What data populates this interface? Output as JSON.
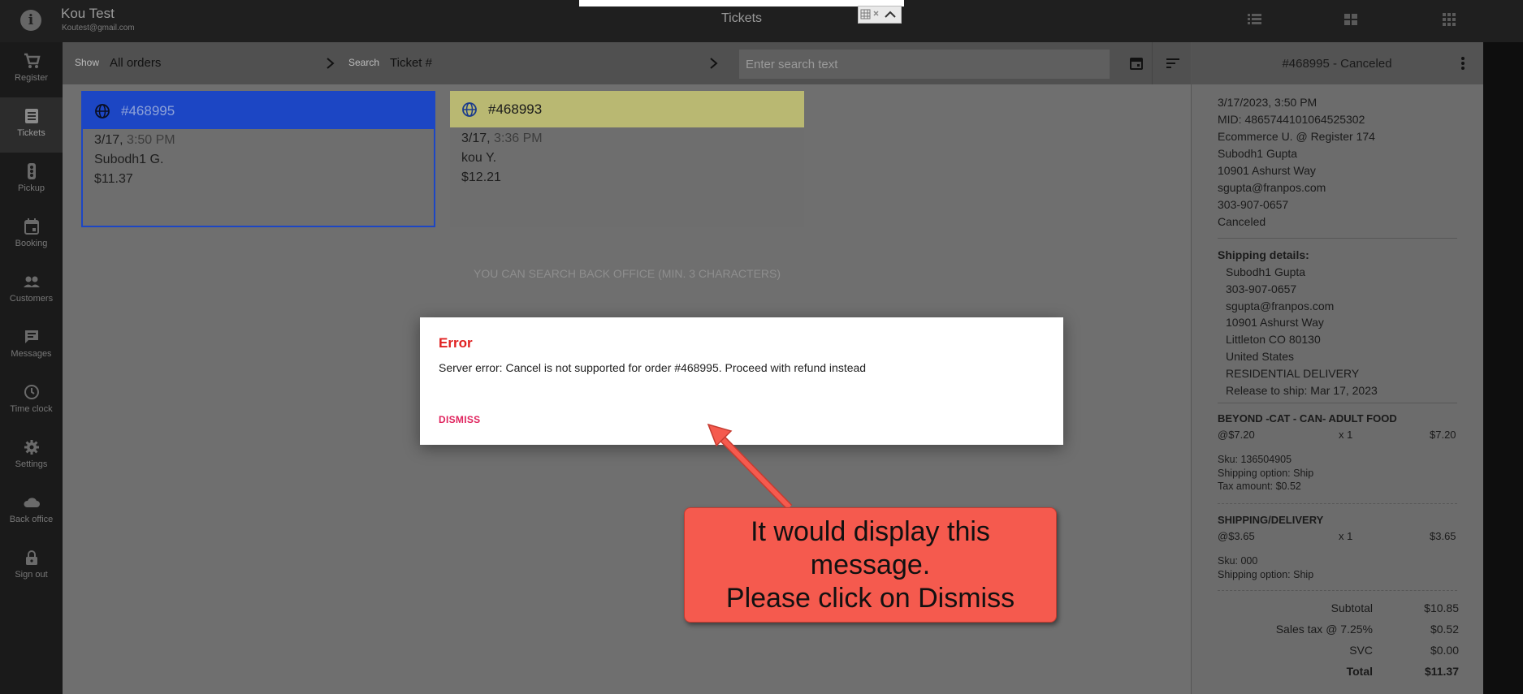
{
  "app": {
    "title": "Tickets"
  },
  "user": {
    "name": "Kou Test",
    "email": "Koutest@gmail.com"
  },
  "nav": [
    {
      "label": "Register",
      "icon": "cart-icon"
    },
    {
      "label": "Tickets",
      "icon": "receipt-icon",
      "active": true
    },
    {
      "label": "Pickup",
      "icon": "traffic-light-icon"
    },
    {
      "label": "Booking",
      "icon": "calendar-icon"
    },
    {
      "label": "Customers",
      "icon": "people-icon"
    },
    {
      "label": "Messages",
      "icon": "chat-icon"
    },
    {
      "label": "Time clock",
      "icon": "clock-icon"
    },
    {
      "label": "Settings",
      "icon": "gear-icon"
    },
    {
      "label": "Back office",
      "icon": "cloud-icon"
    },
    {
      "label": "Sign out",
      "icon": "lock-icon"
    }
  ],
  "toolbar": {
    "show_label": "Show",
    "show_value": "All orders",
    "search_label": "Search",
    "search_value": "Ticket #",
    "search_placeholder": "Enter search text"
  },
  "tickets": [
    {
      "id": "#468995",
      "date": "3/17,",
      "time": "3:50 PM",
      "customer": "Subodh1 G.",
      "total": "$11.37",
      "header_color": "#1c46c4",
      "selected": true
    },
    {
      "id": "#468993",
      "date": "3/17,",
      "time": "3:36 PM",
      "customer": "kou Y.",
      "total": "$12.21",
      "header_color": "#b9b872",
      "selected": false
    }
  ],
  "hint": "YOU CAN SEARCH BACK OFFICE (MIN. 3 CHARACTERS)",
  "detail": {
    "title": "#468995 - Canceled",
    "info_lines": [
      "3/17/2023, 3:50 PM",
      "MID: 4865744101064525302",
      "Ecommerce U. @ Register 174",
      "Subodh1 Gupta",
      "10901 Ashurst Way",
      "sgupta@franpos.com",
      "303-907-0657",
      "Canceled"
    ],
    "shipping_title": "Shipping details:",
    "shipping_lines": [
      "Subodh1 Gupta",
      "303-907-0657",
      "sgupta@franpos.com",
      "10901 Ashurst Way",
      "Littleton CO 80130",
      "United States",
      "RESIDENTIAL DELIVERY",
      "Release to ship: Mar 17, 2023"
    ],
    "items": [
      {
        "name": "BEYOND -CAT - CAN- ADULT FOOD",
        "price": "@$7.20",
        "qty": "x  1",
        "amount": "$7.20",
        "sub": [
          "Sku: 136504905",
          "Shipping option: Ship",
          "Tax amount: $0.52"
        ]
      },
      {
        "name": "SHIPPING/DELIVERY",
        "price": "@$3.65",
        "qty": "x  1",
        "amount": "$3.65",
        "sub": [
          "Sku: 000",
          "Shipping option: Ship"
        ]
      }
    ],
    "totals": [
      {
        "label": "Subtotal",
        "value": "$10.85"
      },
      {
        "label": "Sales tax @ 7.25%",
        "value": "$0.52"
      },
      {
        "label": "SVC",
        "value": "$0.00"
      },
      {
        "label": "Total",
        "value": "$11.37"
      }
    ]
  },
  "dialog": {
    "title": "Error",
    "message": "Server error: Cancel is not supported for order #468995. Proceed with refund instead",
    "dismiss_label": "DISMISS"
  },
  "annotation": {
    "lines": [
      "It would display this",
      "message.",
      "Please click on Dismiss"
    ],
    "color": "#f55a4e"
  }
}
